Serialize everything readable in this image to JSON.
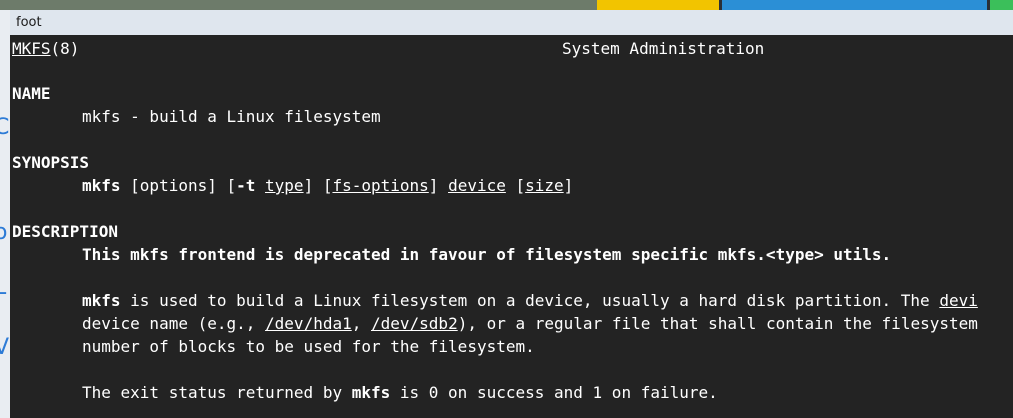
{
  "window": {
    "title": "foot"
  },
  "man": {
    "header_name": "MKFS",
    "header_section": "(8)",
    "header_center": "System Administration",
    "name_heading": "NAME",
    "name_text": "mkfs - build a Linux filesystem",
    "synopsis_heading": "SYNOPSIS",
    "synopsis": {
      "cmd": "mkfs",
      "p1": " [options] [",
      "opt_t": "-t",
      "p2": " ",
      "type": "type",
      "p3": "] [",
      "fs_options": "fs-options",
      "p4": "] ",
      "device": "device",
      "p5": " [",
      "size": "size",
      "p6": "]"
    },
    "description_heading": "DESCRIPTION",
    "deprecation": "This mkfs frontend is deprecated in favour of filesystem specific mkfs.<type> utils.",
    "para1": {
      "cmd": "mkfs",
      "text": " is used to build a Linux filesystem on a device, usually a hard disk partition. The ",
      "device_link": "devi"
    },
    "para2": {
      "pre": "device name (e.g., ",
      "hda1": "/dev/hda1",
      "mid": ", ",
      "sdb2": "/dev/sdb2",
      "post": "), or a regular file that shall contain the filesystem"
    },
    "para3": "number of blocks to be used for the filesystem.",
    "exit": {
      "pre": "The exit status returned by ",
      "cmd": "mkfs",
      "post": " is 0 on success and 1 on failure."
    }
  }
}
